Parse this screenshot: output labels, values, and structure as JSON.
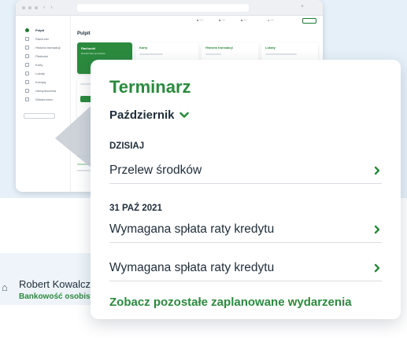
{
  "mini_app": {
    "header_title": "Pulpit",
    "card_accounts_title": "Rachunki",
    "card_accounts_sub": "Rozwiń listę produktów",
    "card_cards_title": "Karty",
    "card_history_title": "Historia transakcji",
    "card_loans_title": "Lokaty",
    "sidebar_items": [
      "Pulpit",
      "Rachunki",
      "Historia transakcji",
      "Płatności",
      "Karty",
      "Lokaty",
      "Kredyty",
      "Ubezpieczenia",
      "Wiadomości"
    ]
  },
  "account": {
    "name": "Robert Kowalczyk",
    "type": "Bankowość osobista"
  },
  "calendar": {
    "title": "Terminarz",
    "month": "Październik",
    "today_label": "DZISIAJ",
    "today_event": "Przelew środków",
    "date_label": "31 PAŹ 2021",
    "event_1": "Wymagana spłata raty kredytu",
    "event_2": "Wymagana spłata raty kredytu",
    "more_link": "Zobacz pozostałe zaplanowane wydarzenia"
  },
  "colors": {
    "accent_green": "#2b8a3e",
    "background_panel": "#e6f0f8",
    "text_dark": "#1f2d3a"
  }
}
